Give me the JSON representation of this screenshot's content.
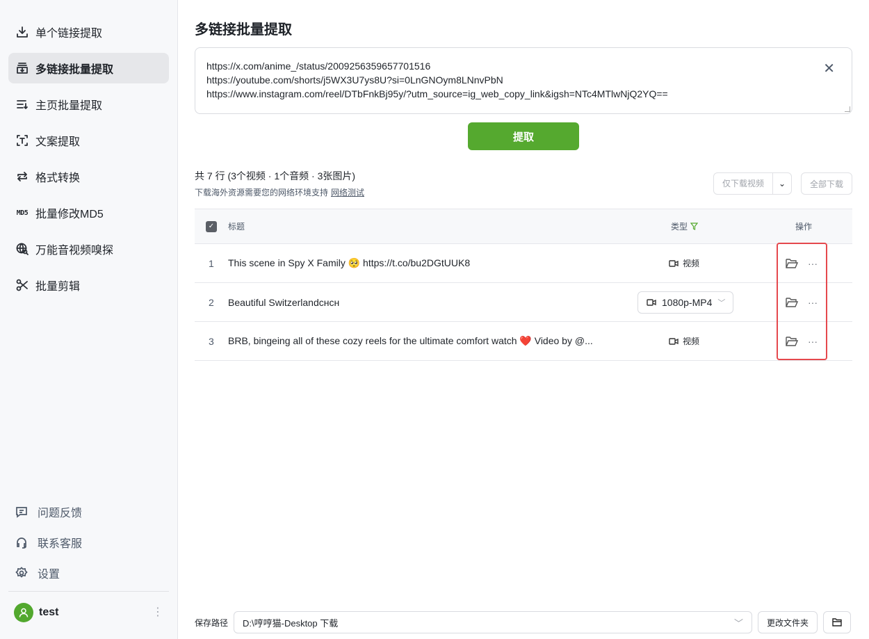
{
  "sidebar": {
    "items": [
      {
        "label": "单个链接提取",
        "icon": "download-icon"
      },
      {
        "label": "多链接批量提取",
        "icon": "batch-download-icon",
        "active": true
      },
      {
        "label": "主页批量提取",
        "icon": "list-download-icon"
      },
      {
        "label": "文案提取",
        "icon": "text-scan-icon"
      },
      {
        "label": "格式转换",
        "icon": "convert-icon"
      },
      {
        "label": "批量修改MD5",
        "icon": "md5-icon",
        "icon_text": "MD5"
      },
      {
        "label": "万能音视频嗅探",
        "icon": "globe-search-icon"
      },
      {
        "label": "批量剪辑",
        "icon": "scissors-icon"
      }
    ],
    "bottom": [
      {
        "label": "问题反馈"
      },
      {
        "label": "联系客服"
      },
      {
        "label": "设置"
      }
    ],
    "user": {
      "name": "test"
    }
  },
  "main": {
    "title": "多链接批量提取",
    "links": [
      "https://x.com/anime_/status/2009256359657701516",
      "https://youtube.com/shorts/j5WX3U7ys8U?si=0LnGNOym8LNnvPbN",
      "https://www.instagram.com/reel/DTbFnkBj95y/?utm_source=ig_web_copy_link&igsh=NTc4MTlwNjQ2YQ=="
    ],
    "extract_label": "提取",
    "summary": "共 7 行 (3个视频 · 1个音频 · 3张图片)",
    "hint": "下载海外资源需要您的网络环境支持",
    "hint_link": "网络测试",
    "video_only_label": "仅下载视频",
    "download_all_label": "全部下载",
    "table": {
      "headers": {
        "title": "标题",
        "type": "类型",
        "actions": "操作"
      },
      "rows": [
        {
          "index": "1",
          "title": "This scene in Spy X Family 🥺 https://t.co/bu2DGtUUK8",
          "type": "视频"
        },
        {
          "index": "2",
          "title": "Beautiful Switzerlandснсн",
          "format": "1080p-MP4"
        },
        {
          "index": "3",
          "title": "BRB, bingeing all of these cozy reels for the ultimate comfort watch ❤️ Video by @...",
          "type": "视频"
        }
      ]
    },
    "footer": {
      "label": "保存路径",
      "path": "D:\\哼哼猫-Desktop 下载",
      "change_label": "更改文件夹"
    }
  },
  "colors": {
    "accent": "#55a92f",
    "highlight": "#e5484d"
  }
}
